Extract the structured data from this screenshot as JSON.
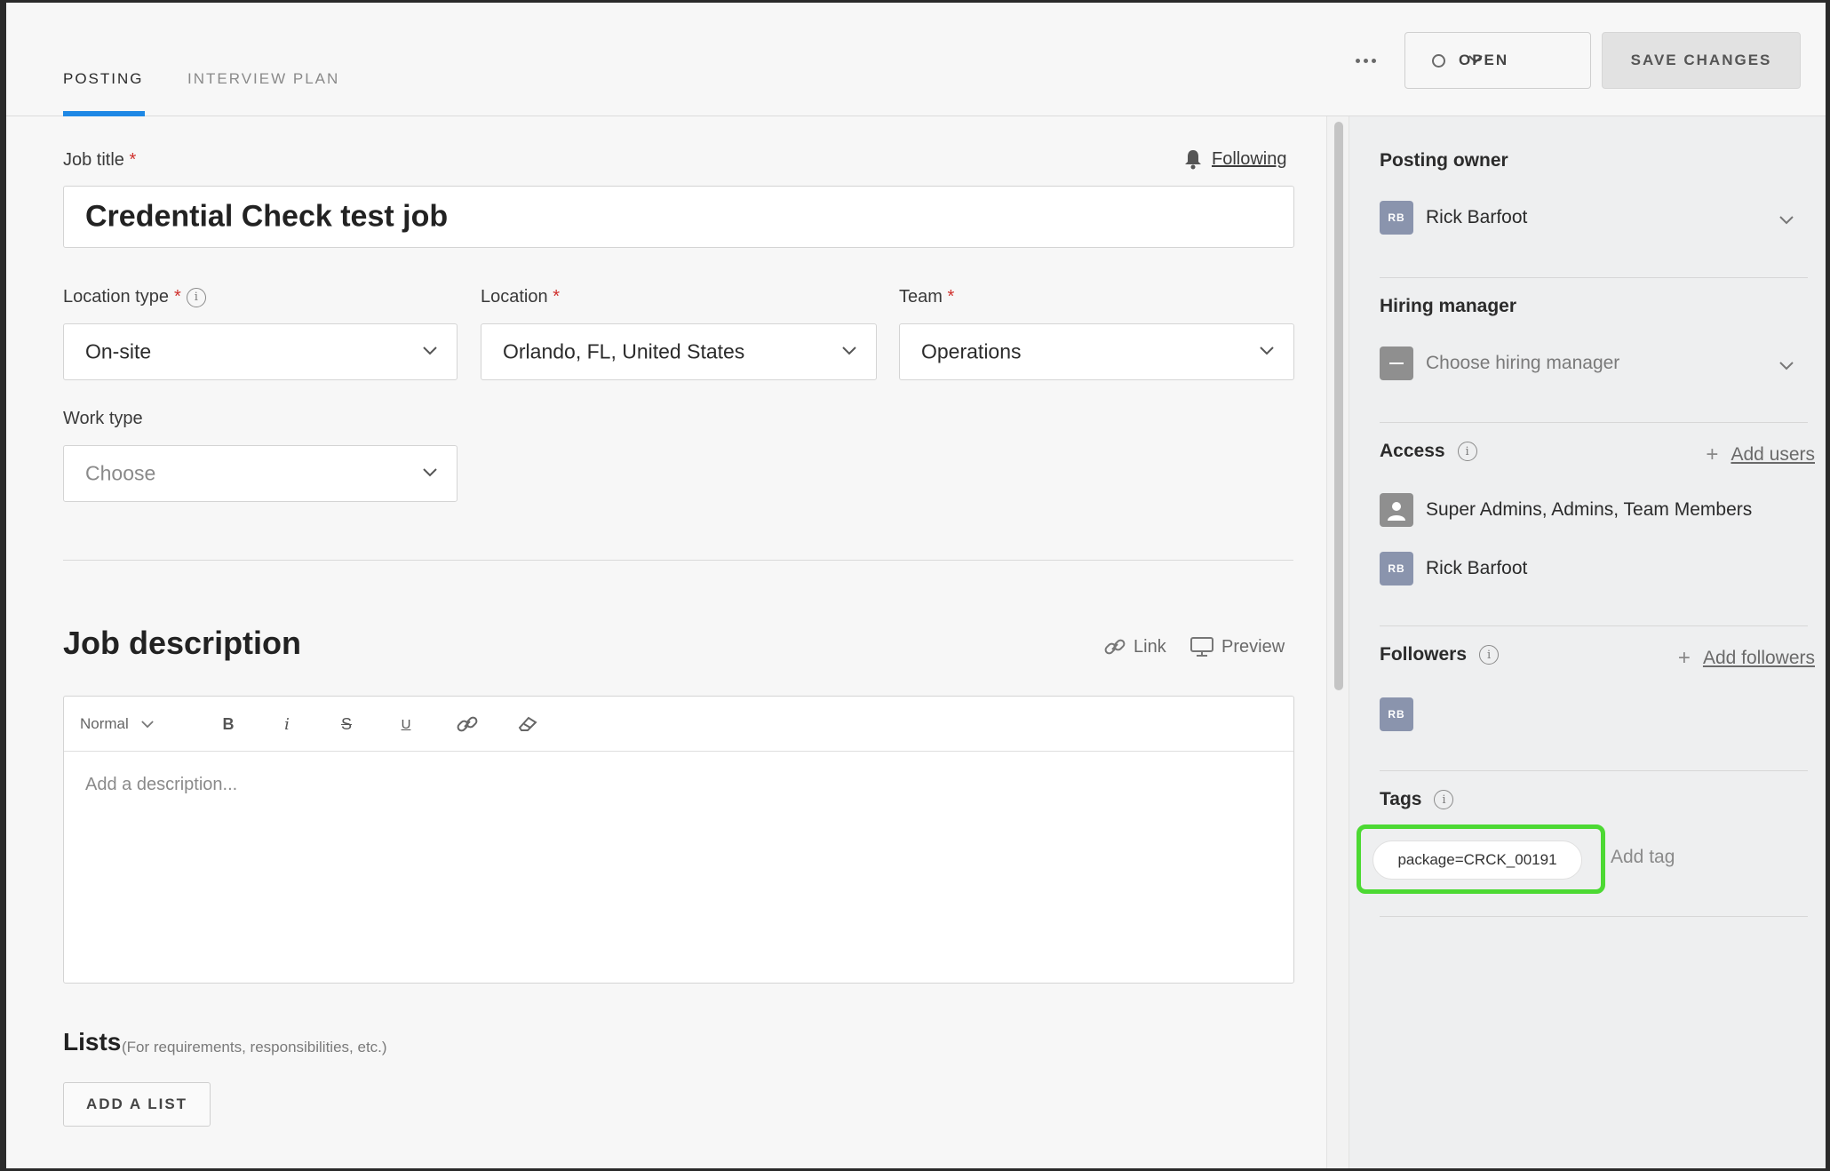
{
  "tabs": [
    {
      "label": "POSTING",
      "active": true
    },
    {
      "label": "INTERVIEW PLAN",
      "active": false
    }
  ],
  "header": {
    "status_label": "OPEN",
    "save_label": "SAVE CHANGES"
  },
  "form": {
    "job_title_label": "Job title",
    "required_mark": "*",
    "following_label": "Following",
    "job_title_value": "Credential Check test job",
    "location_type_label": "Location type",
    "location_type_value": "On-site",
    "location_label": "Location",
    "location_value": "Orlando, FL, United States",
    "team_label": "Team",
    "team_value": "Operations",
    "work_type_label": "Work type",
    "work_type_placeholder": "Choose"
  },
  "description": {
    "title": "Job description",
    "link_label": "Link",
    "preview_label": "Preview",
    "format_value": "Normal",
    "placeholder": "Add a description..."
  },
  "lists": {
    "title": "Lists",
    "note": "(For requirements, responsibilities, etc.)",
    "add_button": "ADD A LIST"
  },
  "sidebar": {
    "posting_owner_label": "Posting owner",
    "posting_owner_name": "Rick Barfoot",
    "posting_owner_initials": "RB",
    "hiring_manager_label": "Hiring manager",
    "hiring_manager_placeholder": "Choose hiring manager",
    "access_label": "Access",
    "add_users_label": "Add users",
    "access_group": "Super Admins, Admins, Team Members",
    "access_user": "Rick Barfoot",
    "access_user_initials": "RB",
    "followers_label": "Followers",
    "add_followers_label": "Add followers",
    "follower_initials": "RB",
    "tags_label": "Tags",
    "tag_value": "package=CRCK_00191",
    "add_tag_label": "Add tag"
  },
  "colors": {
    "accent": "#1e88e5",
    "required": "#d0312d",
    "highlight": "#4cd933",
    "avatar": "#8a94ad"
  }
}
